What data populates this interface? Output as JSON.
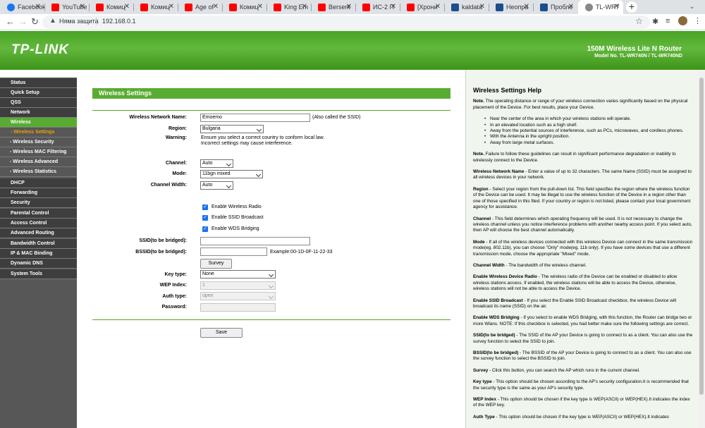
{
  "browser": {
    "tabs": [
      {
        "label": "Facebook",
        "color": "#1877f2"
      },
      {
        "label": "YouTube",
        "color": "#ff0000"
      },
      {
        "label": "Комиц",
        "color": "#ff0000"
      },
      {
        "label": "Комиц",
        "color": "#ff0000"
      },
      {
        "label": "Age of",
        "color": "#ff0000"
      },
      {
        "label": "Комиц",
        "color": "#ff0000"
      },
      {
        "label": "King Em",
        "color": "#ff0000"
      },
      {
        "label": "Berserk",
        "color": "#ff0000"
      },
      {
        "label": "ИС-2 П",
        "color": "#ff0000"
      },
      {
        "label": "[Хрони",
        "color": "#ff0000"
      },
      {
        "label": "kaldata",
        "color": "#1b4d8c"
      },
      {
        "label": "Неопра",
        "color": "#1b4d8c"
      },
      {
        "label": "Пробле",
        "color": "#1b4d8c"
      },
      {
        "label": "TL-WR7",
        "color": "#888888"
      }
    ],
    "security_label": "Няма защита",
    "url": "192.168.0.1"
  },
  "header": {
    "logo": "TP-LINK",
    "product_line1": "150M Wireless Lite N Router",
    "product_line2": "Model No. TL-WR740N / TL-WR740ND"
  },
  "menu": [
    "Status",
    "Quick Setup",
    "QSS",
    "Network",
    "Wireless",
    "- Wireless Settings",
    "- Wireless Security",
    "- Wireless MAC Filtering",
    "- Wireless Advanced",
    "- Wireless Statistics",
    "DHCP",
    "Forwarding",
    "Security",
    "Parental Control",
    "Access Control",
    "Advanced Routing",
    "Bandwidth Control",
    "IP & MAC Binding",
    "Dynamic DNS",
    "System Tools"
  ],
  "form": {
    "title": "Wireless Settings",
    "ssid_label": "Wireless Network Name:",
    "ssid_value": "Emoemo",
    "ssid_note": "(Also called the SSID)",
    "region_label": "Region:",
    "region_value": "Bulgaria",
    "warning_label": "Warning:",
    "warning_line1": "Ensure you select a correct country to conform local law.",
    "warning_line2": "Incorrect settings may cause interference.",
    "channel_label": "Channel:",
    "channel_value": "Auto",
    "mode_label": "Mode:",
    "mode_value": "11bgn mixed",
    "width_label": "Channel Width:",
    "width_value": "Auto",
    "radio_label": "Enable Wireless Radio",
    "broadcast_label": "Enable SSID Broadcast",
    "wds_label": "Enable WDS Bridging",
    "ssid_bridged_label": "SSID(to be bridged):",
    "bssid_bridged_label": "BSSID(to be bridged):",
    "bssid_example": "Example:00-1D-0F-11-22-33",
    "survey_label": "Survey",
    "keytype_label": "Key type:",
    "keytype_value": "None",
    "wepindex_label": "WEP Index:",
    "wepindex_value": "1",
    "authtype_label": "Auth type:",
    "authtype_value": "open",
    "password_label": "Password:",
    "save_label": "Save"
  },
  "help": {
    "title": "Wireless Settings Help",
    "note1_label": "Note.",
    "note1": " The operating distance or range of your wireless connection varies significantly based on the physical placement of the Device. For best results, place your Device.",
    "bullets": [
      "Near the center of the area in which your wireless stations will operate.",
      "In an elevated location such as a high shelf.",
      "Away from the potential sources of interference, such as PCs, microwaves, and cordless phones.",
      "With the Antenna in the upright position.",
      "Away from large metal surfaces."
    ],
    "note2_label": "Note.",
    "note2": " Failure to follow these guidelines can result in significant performance degradation or inability to wirelessly connect to the Device.",
    "p_ssid_label": "Wireless Network Name",
    "p_ssid": " - Enter a value of up to 32 characters. The same Name (SSID) must be assigned to all wireless devices in your network.",
    "p_region_label": "Region",
    "p_region": " - Select your region from the pull-down list. This field specifies the region where the wireless function of the Device can be used. It may be illegal to use the wireless function of the Device in a region other than one of those specified in this filed. If your country or region is not listed, please contact your local government agency for assistance.",
    "p_channel_label": "Channel",
    "p_channel": " - This field determines which operating frequency will be used. It is not necessary to change the wireless channel unless you notice interference problems with another nearby access point. If you select auto, then AP will choose the best channel automatically.",
    "p_mode_label": "Mode",
    "p_mode": " - If all of the wireless devices connected with this wireless Device can connect in the same transmission mode(eg. 802.11b), you can choose \"Only\" mode(eg. 11b only). If you have some devices that use a different transmission mode, choose the appropriate \"Mixed\" mode.",
    "p_width_label": "Channel Width",
    "p_width": " - The bandwidth of the wireless channel.",
    "p_radio_label": "Enable Wireless Device Radio",
    "p_radio": " - The wireless radio of the Device can be enabled or disabled to allow wireless stations access. If enabled, the wireless stations will be able to access the Device, otherwise, wireless stations will not be able to access the Device.",
    "p_bcast_label": "Enable SSID Broadcast",
    "p_bcast": " - If you select the Enable SSID Broadcast checkbox, the wireless Device will broadcast its name (SSID) on the air.",
    "p_wds_label": "Enable WDS Bridging",
    "p_wds": " - If you select to enable WDS Bridging, with this function, the Router can bridge two or more Wlans. NOTE: If this checkbox is selected, you had better make sure the following settings are correct.",
    "p_wds_extra": "",
    "p_sb_label": "SSID(to be bridged)",
    "p_sb": " - The SSID of the AP your Device is going to connect to as a client. You can also use the survey function to select the SSID to join.",
    "p_bb_label": "BSSID(to be bridged)",
    "p_bb": " - The BSSID of the AP your Device is going to connect to as a client. You can also use the survey function to select the BSSID to join.",
    "p_survey_label": "Survey",
    "p_survey": " - Click this button, you can search the AP which runs in the current channel.",
    "p_key_label": "Key type",
    "p_key": " - This option should be chosen according to the AP's security configuration.It is recommended that the security type is the same as your AP's security type.",
    "p_wep_label": "WEP Index",
    "p_wep": " - This option should be chosen if the key type is WEP(ASCII) or WEP(HEX).It indicates the index of the WEP key.",
    "p_auth_label": "Auth Type",
    "p_auth": " - This option should be chosen if the key type is WEP(ASCII) or WEP(HEX).It indicates"
  }
}
